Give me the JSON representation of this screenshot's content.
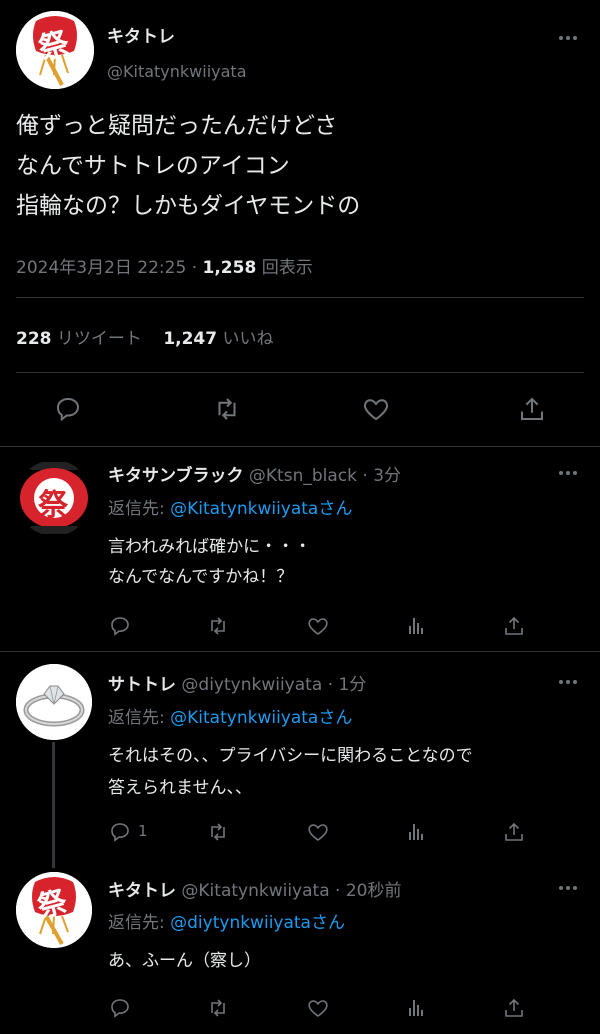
{
  "main_tweet": {
    "display_name": "キタトレ",
    "handle": "@Kitatynkwiiyata",
    "text_lines": [
      "俺ずっと疑問だったんだけどさ",
      "なんでサトトレのアイコン",
      "指輪なの？しかもダイヤモンドの"
    ],
    "timestamp": "2024年3月2日 22:25",
    "separator": "·",
    "views": "1,258",
    "views_label": "回表示",
    "retweets": "228",
    "retweets_label": "リツイート",
    "likes": "1,247",
    "likes_label": "いいね"
  },
  "replies": [
    {
      "display_name": "キタサンブラック",
      "handle": "@Ktsn_black",
      "time": "· 3分",
      "reply_prefix": "返信先:",
      "reply_to": "@Kitatynkwiiyata",
      "reply_suffix": "さん",
      "text_lines": [
        "言われみれば確かに・・・",
        "なんでなんですかね！？"
      ],
      "reply_count": ""
    },
    {
      "display_name": "サトトレ",
      "handle": "@diytynkwiiyata",
      "time": "· 1分",
      "reply_prefix": "返信先:",
      "reply_to": "@Kitatynkwiiyata",
      "reply_suffix": "さん",
      "text_lines": [
        "それはその、、プライバシーに関わることなので",
        "答えられません、、"
      ],
      "reply_count": "1"
    },
    {
      "display_name": "キタトレ",
      "handle": "@Kitatynkwiiyata",
      "time": "· 20秒前",
      "reply_prefix": "返信先:",
      "reply_to": "@diytynkwiiyata",
      "reply_suffix": "さん",
      "text_lines": [
        "あ、ふーん（察し）"
      ],
      "reply_count": ""
    }
  ],
  "avatar_glyph": "祭",
  "colors": {
    "background": "#000000",
    "text": "#e7e9ea",
    "muted": "#71767b",
    "link": "#1d9bf0",
    "divider": "#2f3336",
    "festival_red": "#d7232b"
  }
}
